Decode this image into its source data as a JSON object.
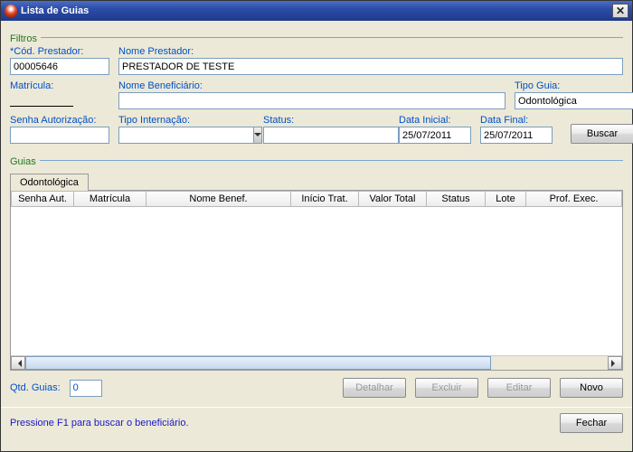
{
  "window": {
    "title": "Lista de Guias"
  },
  "filtros": {
    "legend": "Filtros",
    "cod_prestador": {
      "label": "*Cód. Prestador:",
      "value": "00005646"
    },
    "nome_prestador": {
      "label": "Nome Prestador:",
      "value": "PRESTADOR DE TESTE"
    },
    "matricula": {
      "label": "Matrícula:",
      "value": ""
    },
    "nome_benef": {
      "label": "Nome Beneficiário:",
      "value": ""
    },
    "tipo_guia": {
      "label": "Tipo Guia:",
      "value": "Odontológica"
    },
    "senha_aut": {
      "label": "Senha Autorização:",
      "value": ""
    },
    "tipo_intern": {
      "label": "Tipo Internação:",
      "value": ""
    },
    "status": {
      "label": "Status:",
      "value": ""
    },
    "data_inicial": {
      "label": "Data Inicial:",
      "value": "25/07/2011"
    },
    "data_final": {
      "label": "Data Final:",
      "value": "25/07/2011"
    },
    "buscar": "Buscar"
  },
  "guias": {
    "legend": "Guias",
    "tab": "Odontológica",
    "columns": [
      "Senha Aut.",
      "Matrícula",
      "Nome Benef.",
      "Início Trat.",
      "Valor Total",
      "Status",
      "Lote",
      "Prof. Exec."
    ],
    "qtd_label": "Qtd. Guias:",
    "qtd_value": "0",
    "buttons": {
      "detalhar": "Detalhar",
      "excluir": "Excluir",
      "editar": "Editar",
      "novo": "Novo"
    }
  },
  "footer": {
    "hint": "Pressione F1 para buscar o beneficiário.",
    "fechar": "Fechar"
  }
}
